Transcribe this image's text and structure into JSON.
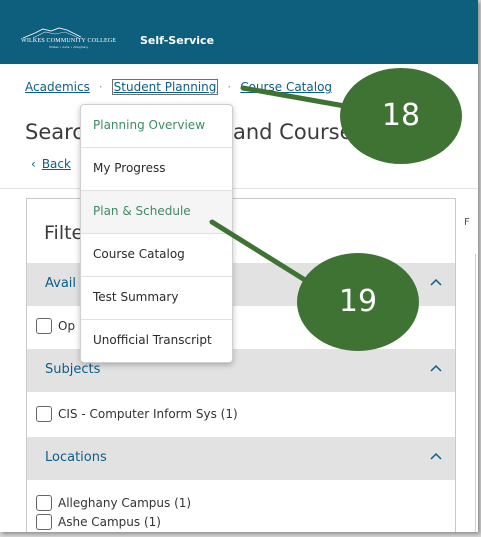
{
  "header": {
    "logo_text": "WILKES COMMUNITY COLLEGE",
    "logo_tagline": "Wilkes • Ashe • Alleghany",
    "app_title": "Self-Service",
    "bg_color": "#0e5e7e"
  },
  "breadcrumb": {
    "items": [
      "Academics",
      "Student Planning",
      "Course Catalog"
    ]
  },
  "page": {
    "title_left": "Searc",
    "title_right": "and Course",
    "back_icon": "‹",
    "back_label": "Back"
  },
  "filters": {
    "title": "Filte",
    "sections": [
      {
        "label": "Avail",
        "options": [
          "Op"
        ]
      },
      {
        "label": "Subjects",
        "options": [
          "CIS - Computer Inform Sys (1)"
        ]
      },
      {
        "label": "Locations",
        "options": [
          "Alleghany Campus (1)",
          "Ashe Campus (1)"
        ]
      }
    ]
  },
  "right_col_letter": "F",
  "dropdown_menu": {
    "items": [
      {
        "label": "Planning Overview",
        "color": "#3f8a64"
      },
      {
        "label": "My Progress",
        "color": "#2b2b2b"
      },
      {
        "label": "Plan & Schedule",
        "color": "#3f8a64"
      },
      {
        "label": "Course Catalog",
        "color": "#2b2b2b"
      },
      {
        "label": "Test Summary",
        "color": "#2b2b2b"
      },
      {
        "label": "Unofficial Transcript",
        "color": "#2b2b2b"
      }
    ]
  },
  "callouts": [
    {
      "number": "18",
      "color": "#3f7334"
    },
    {
      "number": "19",
      "color": "#3f7334"
    }
  ]
}
